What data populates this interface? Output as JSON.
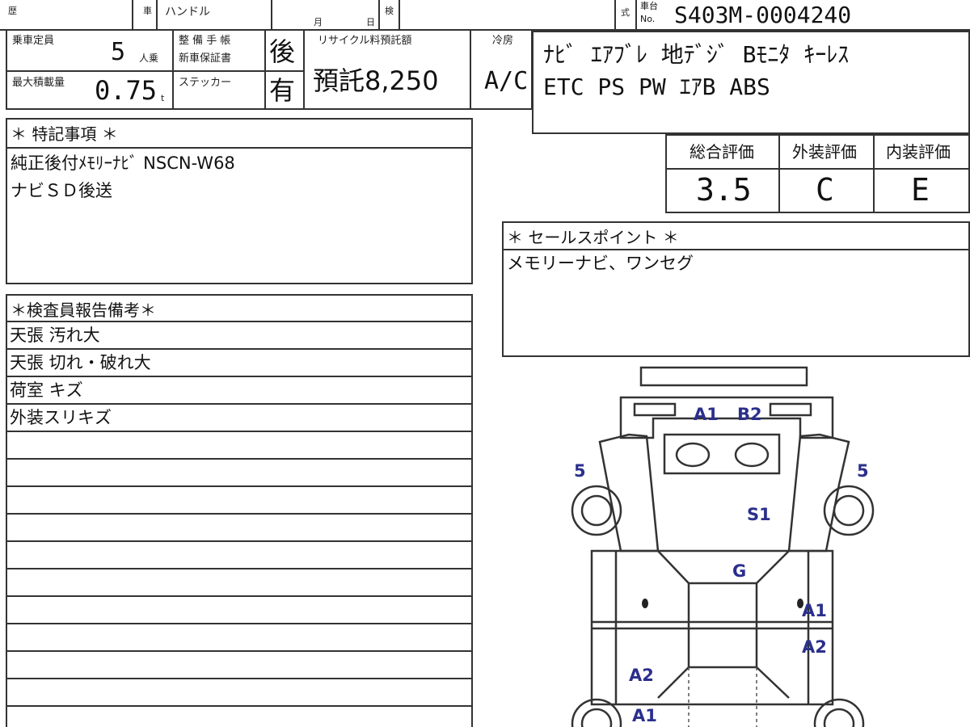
{
  "top_row": {
    "history_label": "歴",
    "car_label": "車",
    "handle_label": "ハンドル",
    "month_label": "月",
    "day_label": "日",
    "inspection_label": "検",
    "model_label": "式",
    "chassis_label_top": "車台",
    "chassis_label_bottom": "No.",
    "chassis_number": "S403M-0004240"
  },
  "specs": {
    "capacity_label": "乗車定員",
    "capacity_value": "5",
    "capacity_unit": "人乗",
    "maintenance_label_1": "整 備 手 帳",
    "maintenance_label_2": "新車保証書",
    "maintenance_value": "後",
    "recycle_label": "リサイクル料預託額",
    "recycle_value": "預託8,250",
    "cooling_label": "冷房",
    "cooling_value": "A/C",
    "max_load_label": "最大積載量",
    "max_load_value": "0.75",
    "max_load_unit": "t",
    "sticker_label": "ステッカー",
    "sticker_value": "有"
  },
  "equipment": {
    "line1": "ﾅﾋﾞ ｴｱﾌﾞﾚ 地ﾃﾞｼﾞ Bﾓﾆﾀ ｷｰﾚｽ",
    "line2": "ETC PS PW ｴｱB ABS"
  },
  "special_notes": {
    "title": "＊ 特記事項 ＊",
    "lines": [
      "純正後付ﾒﾓﾘｰﾅﾋﾞ NSCN-W68",
      "ナビＳＤ後送"
    ]
  },
  "ratings": {
    "overall_label": "総合評価",
    "overall_value": "3.5",
    "exterior_label": "外装評価",
    "exterior_value": "C",
    "interior_label": "内装評価",
    "interior_value": "E"
  },
  "sales_point": {
    "title": "＊ セールスポイント ＊",
    "text": "メモリーナビ、ワンセグ"
  },
  "inspector_report": {
    "title": "＊検査員報告備考＊",
    "lines": [
      "天張 汚れ大",
      "天張 切れ・破れ大",
      "荷室 キズ",
      "外装スリキズ"
    ]
  },
  "diagram": {
    "marks": {
      "windshield_a1": "A1",
      "windshield_b2": "B2",
      "left_front_wheel": "5",
      "right_front_wheel": "5",
      "hood": "S1",
      "roof": "G",
      "right_door_a1": "A1",
      "right_rear_a2": "A2",
      "left_rear_a2": "A2",
      "left_rear_a1": "A1"
    },
    "mark_color": "#2b2f8c"
  }
}
